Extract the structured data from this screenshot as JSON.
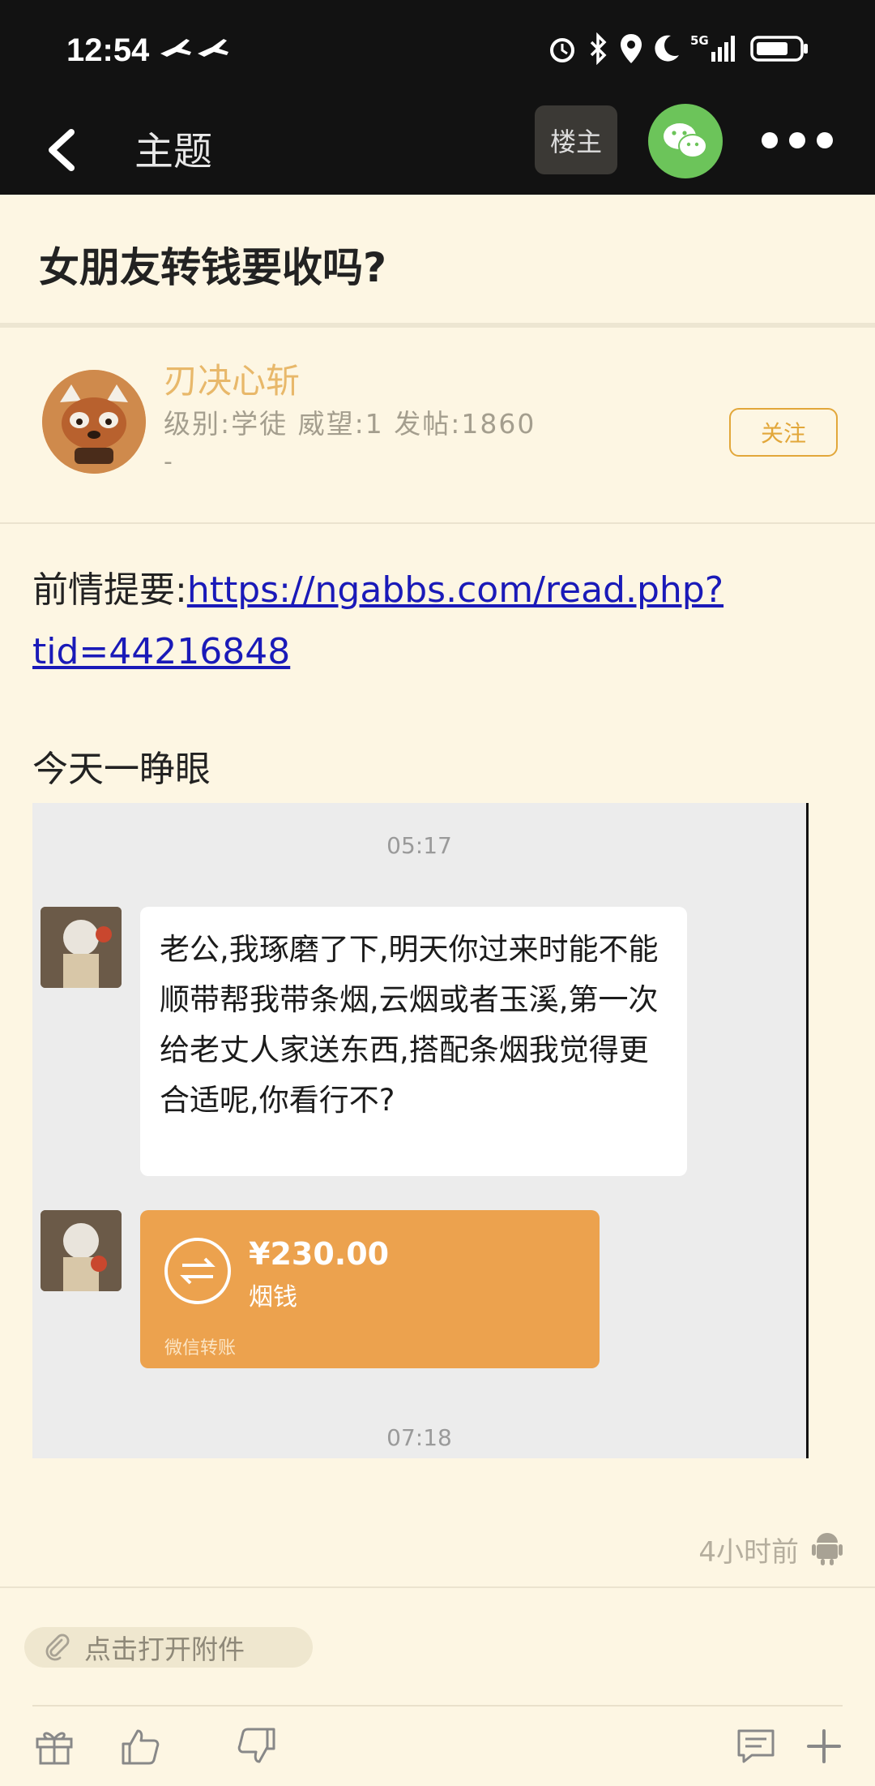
{
  "status_bar": {
    "time": "12:54"
  },
  "appbar": {
    "title": "主题",
    "owner_label": "楼主"
  },
  "thread": {
    "title": "女朋友转钱要收吗?"
  },
  "author": {
    "name": "刃决心斩",
    "meta": "级别:学徒 威望:1 发帖:1860",
    "extra": "-",
    "follow_label": "关注"
  },
  "post": {
    "prefix": "前情提要:",
    "link": "https://ngabbs.com/read.php?tid=44216848",
    "line2": "今天一睁眼",
    "time_ago": "4小时前"
  },
  "chat_screenshot": {
    "time_top": "05:17",
    "message": "老公,我琢磨了下,明天你过来时能不能顺带帮我带条烟,云烟或者玉溪,第一次给老丈人家送东西,搭配条烟我觉得更合适呢,你看行不?",
    "transfer_amount": "¥230.00",
    "transfer_note": "烟钱",
    "transfer_label": "微信转账",
    "time_bottom": "07:18"
  },
  "attachment": {
    "label": "点击打开附件"
  },
  "colors": {
    "accent": "#e2a73a",
    "background": "#fdf6e3",
    "link": "#1a1ab8",
    "wechat": "#6cc45a"
  }
}
